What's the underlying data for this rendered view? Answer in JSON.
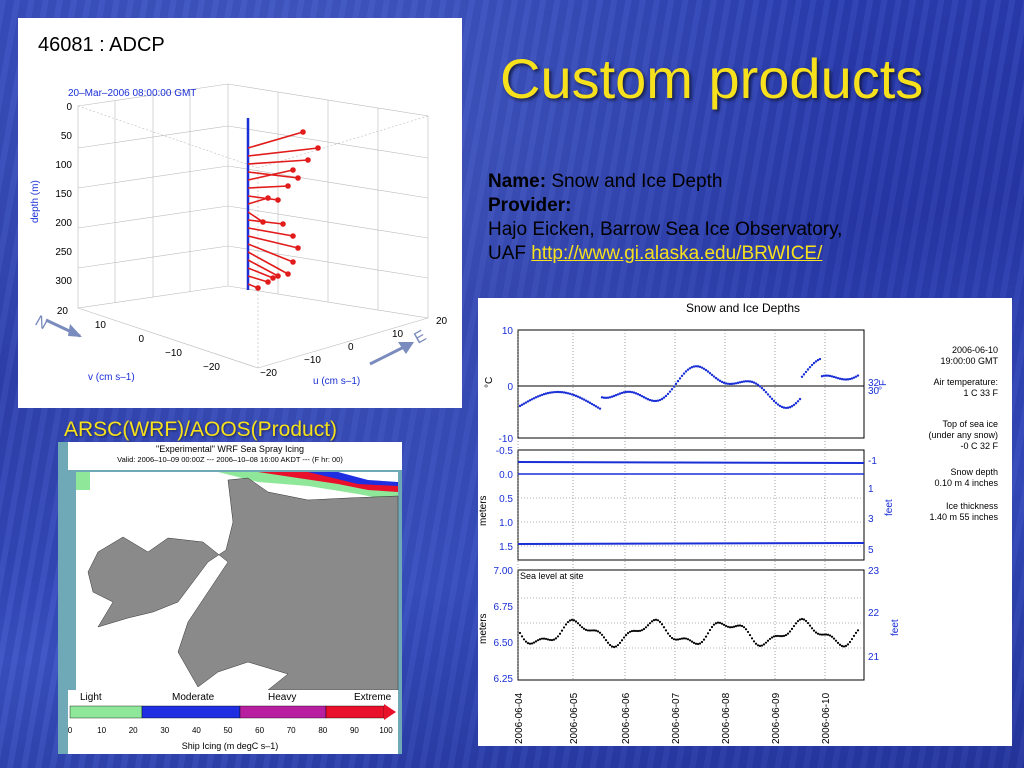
{
  "slide": {
    "title": "Custom products",
    "name_label": "Name:",
    "name_value": "Snow and Ice Depth",
    "provider_label": "Provider:",
    "provider_line1": "Hajo Eicken, Barrow Sea Ice Observatory,",
    "provider_uaf": "UAF",
    "provider_link": "http://www.gi.alaska.edu/BRWICE/",
    "arsc_caption": "ARSC(WRF)/AOOS(Product)"
  },
  "adcp": {
    "title": "46081 : ADCP",
    "timestamp": "20–Mar–2006 08:00:00 GMT",
    "depth_label": "depth (m)",
    "depth_ticks": [
      "0",
      "50",
      "100",
      "150",
      "200",
      "250",
      "300"
    ],
    "v_label": "v (cm s–1)",
    "u_label": "u (cm s–1)",
    "v_ticks": [
      "20",
      "10",
      "0",
      "−10",
      "−20"
    ],
    "u_ticks": [
      "−20",
      "−10",
      "0",
      "10",
      "20"
    ],
    "north": "N",
    "east": "E"
  },
  "icing": {
    "title": "\"Experimental\" WRF Sea Spray Icing",
    "valid": "Valid: 2006–10–09 00:00Z --- 2006–10–08 16:00 AKDT --- (F hr: 00)",
    "categories": [
      "Light",
      "Moderate",
      "Heavy",
      "Extreme"
    ],
    "scale_ticks": [
      "0",
      "10",
      "20",
      "30",
      "40",
      "50",
      "60",
      "70",
      "80",
      "90",
      "100"
    ],
    "scale_label": "Ship Icing (m degC s–1)",
    "colors": [
      "#8fe89a",
      "#1e2ee0",
      "#b81fa0",
      "#e8102a"
    ]
  },
  "depths": {
    "title": "Snow and Ice Depths",
    "timestamp_date": "2006-06-10",
    "timestamp_time": "19:00:00 GMT",
    "air_label": "Air temperature:",
    "air_value": "1 C 33 F",
    "ice_top_label1": "Top of sea ice",
    "ice_top_label2": "(under any snow)",
    "ice_top_value": "-0 C 32 F",
    "snow_label": "Snow depth",
    "snow_value": "0.10 m 4 inches",
    "ice_label": "Ice thickness",
    "ice_value": "1.40 m 55 inches",
    "temp_axis": "°C",
    "temp_axis_f": "°F",
    "temp_ticks": [
      "10",
      "0",
      "-10"
    ],
    "temp_f_ticks": [
      "32",
      "30"
    ],
    "meters_label": "meters",
    "feet_label": "feet",
    "mid_ticks": [
      "-0.5",
      "0.0",
      "0.5",
      "1.0",
      "1.5"
    ],
    "mid_feet_ticks": [
      "-1",
      "1",
      "3",
      "5"
    ],
    "sea_label": "Sea level at site",
    "sea_ticks": [
      "7.00",
      "6.75",
      "6.50",
      "6.25"
    ],
    "sea_feet_ticks": [
      "23",
      "22",
      "21"
    ],
    "dates": [
      "2006-06-04",
      "2006-06-05",
      "2006-06-06",
      "2006-06-07",
      "2006-06-08",
      "2006-06-09",
      "2006-06-10"
    ]
  }
}
